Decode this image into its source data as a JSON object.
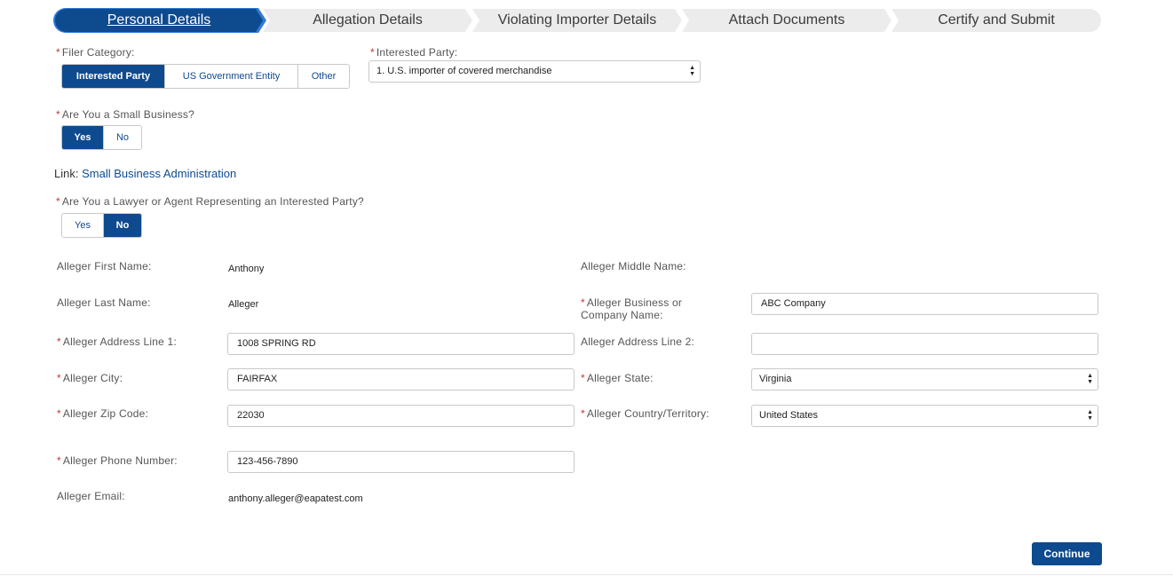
{
  "stepper": {
    "steps": [
      {
        "label": "Personal Details"
      },
      {
        "label": "Allegation Details"
      },
      {
        "label": "Violating Importer Details"
      },
      {
        "label": "Attach Documents"
      },
      {
        "label": "Certify and Submit"
      }
    ],
    "active_index": 0
  },
  "required_marker": "*",
  "filer_category": {
    "label": "Filer Category:",
    "options": [
      "Interested Party",
      "US Government Entity",
      "Other"
    ],
    "selected": "Interested Party"
  },
  "interested_party": {
    "label": "Interested Party:",
    "value": "1. U.S. importer of covered merchandise"
  },
  "small_business": {
    "label": "Are You a Small Business?",
    "options": [
      "Yes",
      "No"
    ],
    "selected": "Yes"
  },
  "link": {
    "prefix": "Link:",
    "text": "Small Business Administration"
  },
  "lawyer_agent": {
    "label": "Are You a Lawyer or Agent Representing an Interested Party?",
    "options": [
      "Yes",
      "No"
    ],
    "selected": "No"
  },
  "fields": {
    "first_name": {
      "label": "Alleger First Name:",
      "value": "Anthony"
    },
    "middle_name": {
      "label": "Alleger Middle Name:",
      "value": ""
    },
    "last_name": {
      "label": "Alleger Last Name:",
      "value": "Alleger"
    },
    "company": {
      "label_line1": "Alleger Business or",
      "label_line2": "Company Name:",
      "value": "ABC Company"
    },
    "address1": {
      "label": "Alleger Address Line 1:",
      "value": "1008 SPRING RD"
    },
    "address2": {
      "label": "Alleger Address Line 2:",
      "value": ""
    },
    "city": {
      "label": "Alleger City:",
      "value": "FAIRFAX"
    },
    "state": {
      "label": "Alleger State:",
      "value": "Virginia"
    },
    "zip": {
      "label": "Alleger Zip Code:",
      "value": "22030"
    },
    "country": {
      "label": "Alleger Country/Territory:",
      "value": "United States"
    },
    "phone": {
      "label": "Alleger Phone Number:",
      "value": "123-456-7890"
    },
    "email": {
      "label": "Alleger Email:",
      "value": "anthony.alleger@eapatest.com"
    }
  },
  "actions": {
    "continue_label": "Continue"
  },
  "icons": {
    "select_arrows": "updown-arrows-icon"
  },
  "colors": {
    "primary": "#0e4a8e",
    "required": "#c23934",
    "step_inactive": "#ececec"
  }
}
